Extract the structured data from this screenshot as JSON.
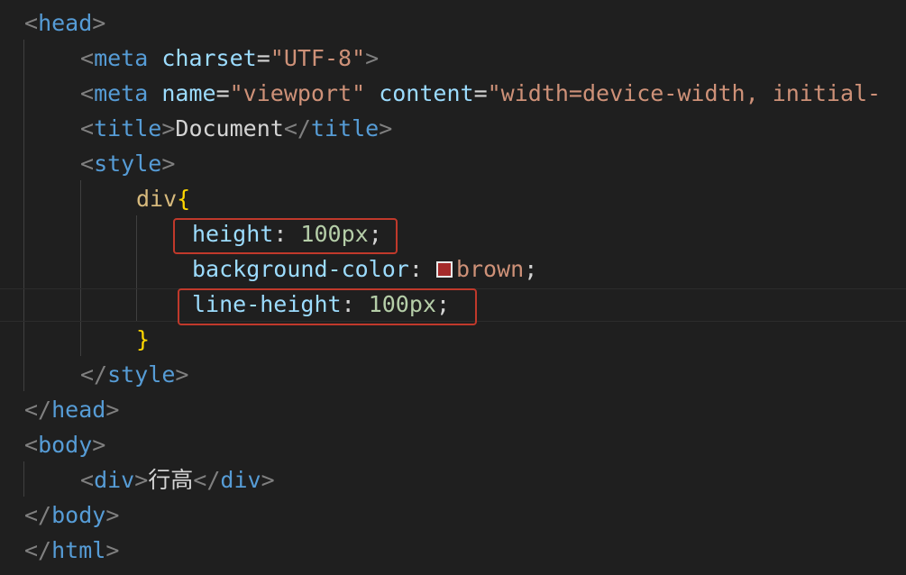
{
  "code": {
    "head_open": "head",
    "meta_tag": "meta",
    "charset_attr": "charset",
    "charset_value": "\"UTF-8\"",
    "name_attr": "name",
    "name_value": "\"viewport\"",
    "content_attr": "content",
    "content_value": "\"width=device-width, initial-",
    "title_tag": "title",
    "title_text": "Document",
    "style_tag": "style",
    "selector": "div",
    "height_prop": "height",
    "height_value": "100px",
    "bg_prop": "background-color",
    "bg_value": "brown",
    "line_height_prop": "line-height",
    "line_height_value": "100px",
    "body_tag": "body",
    "div_tag": "div",
    "div_text": "行高",
    "html_tag": "html"
  },
  "colors": {
    "swatch": "#a52a2a",
    "highlight_border": "#c0392b",
    "background": "#1f1f1f"
  }
}
